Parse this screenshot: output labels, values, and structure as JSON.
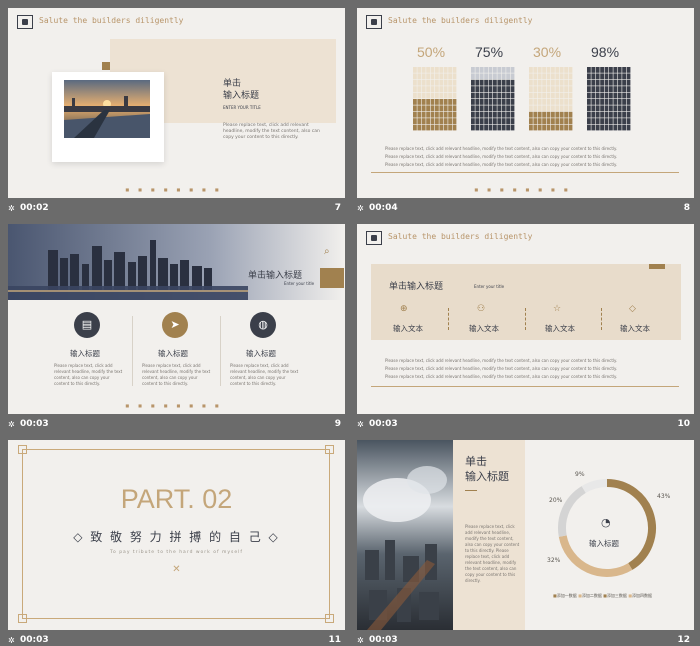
{
  "cells": [
    {
      "duration": "00:02",
      "number": "7"
    },
    {
      "duration": "00:04",
      "number": "8"
    },
    {
      "duration": "00:03",
      "number": "9"
    },
    {
      "duration": "00:03",
      "number": "10"
    },
    {
      "duration": "00:03",
      "number": "11"
    },
    {
      "duration": "00:03",
      "number": "12"
    }
  ],
  "header_text": "Salute  the  builders  diligently",
  "placeholder_en": "Please replace text, click add relevant headline, modify the text content, also can copy your content to this directly.",
  "s7": {
    "title_line1": "单击",
    "title_line2": "输入标题",
    "subtitle": "ENTER YOUR TITLE",
    "body": "Please replace text, click add relevant headline, modify the text content, also can copy your content to this directly."
  },
  "s8": {
    "percents": [
      "50%",
      "75%",
      "30%",
      "98%"
    ],
    "fill_fractions": [
      0.5,
      0.75,
      0.3,
      0.98
    ],
    "colors": [
      "#a1814f",
      "#3b3f4a",
      "#a1814f",
      "#3b3f4a"
    ],
    "lines": [
      "Please replace text, click add relevant headline, modify the text content, also can copy your content to this directly.",
      "Please replace text, click add relevant headline, modify the text content, also can copy your content to this directly.",
      "Please replace text, click add relevant headline, modify the text content, also can copy your content to this directly."
    ]
  },
  "s9": {
    "title": "单击输入标题",
    "subtitle": "Enter your title",
    "items": [
      {
        "label": "输入标题",
        "icon": "document-icon"
      },
      {
        "label": "输入标题",
        "icon": "cursor-icon"
      },
      {
        "label": "输入标题",
        "icon": "globe-icon"
      }
    ],
    "body": "Please replace text, click add relevant headline, modify the text content, also can copy your content to this directly."
  },
  "s10": {
    "title": "单击输入标题",
    "subtitle": "Enter your title",
    "items": [
      "输入文本",
      "输入文本",
      "输入文本",
      "输入文本"
    ],
    "lines": [
      "Please replace text, click add relevant headline, modify the text content, also can copy your content to this directly.",
      "Please replace text, click add relevant headline, modify the text content, also can copy your content to this directly.",
      "Please replace text, click add relevant headline, modify the text content, also can copy your content to this directly."
    ]
  },
  "s11": {
    "part": "PART. 02",
    "motto": "◇ 致 敬 努 力 拼 搏 的 自 己 ◇",
    "tagline": "To pay tribute to the hard work of myself"
  },
  "s12": {
    "title_line1": "单击",
    "title_line2": "输入标题",
    "body": "Please replace text, click add relevant headline, modify the text content, also can copy your content to this directly. Please replace text, click add relevant headline, modify the text content, also can copy your content to this directly.",
    "center_label": "输入标题",
    "legend": [
      "添加一数据",
      "添加二数据",
      "添加三数据",
      "添加四数据"
    ],
    "chart_data": {
      "type": "pie",
      "categories": [
        "43%",
        "32%",
        "20%",
        "9%"
      ],
      "values": [
        43,
        32,
        20,
        9
      ],
      "colors": [
        "#a1814f",
        "#d9b78c",
        "#d4d4d4",
        "#e8e8e8"
      ]
    }
  }
}
